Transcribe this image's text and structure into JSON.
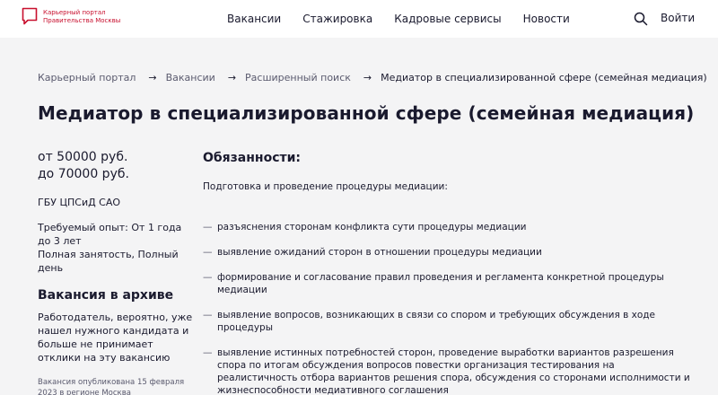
{
  "header": {
    "logo_line1": "Карьерный портал",
    "logo_line2": "Правительства Москвы",
    "nav": [
      "Вакансии",
      "Стажировка",
      "Кадровые сервисы",
      "Новости"
    ],
    "search_icon": "search-icon",
    "login_label": "Войти"
  },
  "breadcrumb": {
    "items": [
      "Карьерный портал",
      "Вакансии",
      "Расширенный поиск"
    ],
    "current": "Медиатор в специализированной сфере (семейная медиация)",
    "separator": "→"
  },
  "page_title": "Медиатор в специализированной сфере (семейная медиация)",
  "sidebar": {
    "salary_from": "от 50000 руб.",
    "salary_to": "до 70000 руб.",
    "company": "ГБУ ЦПСиД САО",
    "experience": "Требуемый опыт: От 1 года до 3 лет",
    "employment": "Полная занятость, Полный день",
    "archive_title": "Вакансия в архиве",
    "archive_text": "Работодатель, вероятно, уже нашел нужного кандидата и больше не принимает отклики на эту вакансию",
    "published": "Вакансия опубликована 15 февраля 2023 в регионе Москва"
  },
  "content": {
    "section_title": "Обязанности:",
    "intro": "Подготовка и проведение процедуры медиации:",
    "dash": "—",
    "duties": [
      "разъяснения сторонам конфликта сути процедуры медиации",
      "выявление ожиданий сторон в отношении процедуры медиации",
      "формирование и согласование правил проведения и регламента конкретной процедуры медиации",
      "выявление вопросов, возникающих в связи со спором и требующих обсуждения в ходе процедуры",
      "выявление истинных потребностей сторон, проведение выработки вариантов разрешения спора по итогам обсуждения вопросов повестки организация тестирования на реалистичность отбора вариантов решения спора, обсуждения со сторонами исполнимости и жизнеспособности медиативного соглашения"
    ]
  },
  "colors": {
    "brand": "#c8102e",
    "text": "#1a1a2e",
    "muted": "#5a5a6e",
    "background": "#f4f4f5"
  }
}
